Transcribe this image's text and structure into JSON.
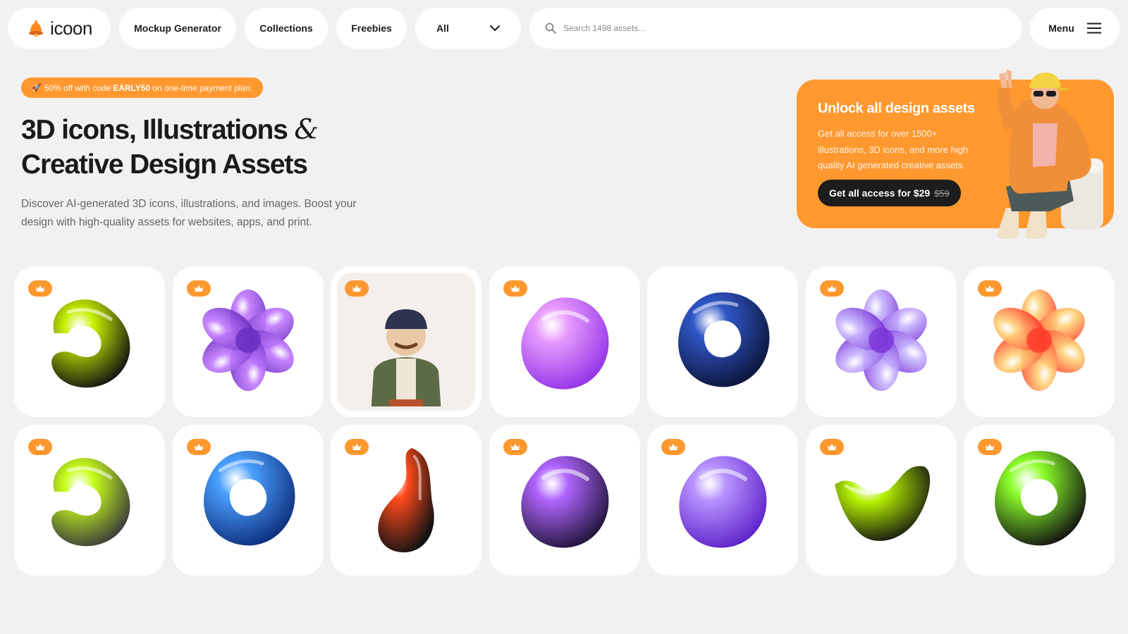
{
  "header": {
    "logo_text": "icoon",
    "nav": [
      "Mockup Generator",
      "Collections",
      "Freebies"
    ],
    "filter_value": "All",
    "search_placeholder": "Search 1498 assets...",
    "menu_label": "Menu"
  },
  "promo": {
    "emoji": "🚀",
    "before": "50% off with code",
    "code": "EARLY50",
    "after": "on one-time payment plan."
  },
  "hero": {
    "title_line1": "3D icons, Illustrations",
    "amp": "&",
    "title_line2": "Creative Design Assets",
    "subtitle": "Discover AI-generated 3D icons, illustrations, and images. Boost your design with high-quality assets for websites, apps, and print."
  },
  "unlock": {
    "title": "Unlock all design assets",
    "description": "Get all access for over 1500+ illustrations, 3D icons, and more high quality AI generated creative assets.",
    "cta_label": "Get all access for $29",
    "old_price": "$59"
  },
  "colors": {
    "accent": "#ff982f",
    "background": "#f1f1f1",
    "card": "#ffffff",
    "dark": "#1d1d1d"
  },
  "assets": [
    {
      "name": "green-black-glass-knot",
      "premium": true,
      "c1": "#c6f000",
      "c2": "#121212",
      "shape": "knot"
    },
    {
      "name": "purple-glass-flower",
      "premium": true,
      "c1": "#c27bff",
      "c2": "#6a2fc0",
      "shape": "flower"
    },
    {
      "name": "man-character",
      "premium": true,
      "c1": "#5c6b45",
      "c2": "#e9c8a6",
      "shape": "person"
    },
    {
      "name": "violet-crumple",
      "premium": true,
      "c1": "#e89bff",
      "c2": "#9233e6",
      "shape": "blob"
    },
    {
      "name": "navy-ring",
      "premium": false,
      "c1": "#3057c8",
      "c2": "#0b1438",
      "shape": "ring"
    },
    {
      "name": "lilac-frill",
      "premium": true,
      "c1": "#c9b6ff",
      "c2": "#7a36d8",
      "shape": "flower"
    },
    {
      "name": "orange-frill",
      "premium": true,
      "c1": "#ffd27a",
      "c2": "#ff3a2a",
      "shape": "flower"
    },
    {
      "name": "lime-smoke-knot",
      "premium": true,
      "c1": "#c8ff1a",
      "c2": "#3b3b3b",
      "shape": "knot"
    },
    {
      "name": "blue-glass-knot",
      "premium": true,
      "c1": "#4aa0ff",
      "c2": "#0d2c7a",
      "shape": "ring"
    },
    {
      "name": "red-black-drop",
      "premium": true,
      "c1": "#ff4a1c",
      "c2": "#121212",
      "shape": "drop"
    },
    {
      "name": "purple-crystal",
      "premium": true,
      "c1": "#b064ff",
      "c2": "#1f1438",
      "shape": "blob"
    },
    {
      "name": "purple-blob",
      "premium": true,
      "c1": "#b893ff",
      "c2": "#5d22c9",
      "shape": "blob"
    },
    {
      "name": "green-wave",
      "premium": true,
      "c1": "#b4f000",
      "c2": "#121212",
      "shape": "wave"
    },
    {
      "name": "black-green-ring",
      "premium": true,
      "c1": "#8cff2a",
      "c2": "#111111",
      "shape": "ring"
    }
  ]
}
